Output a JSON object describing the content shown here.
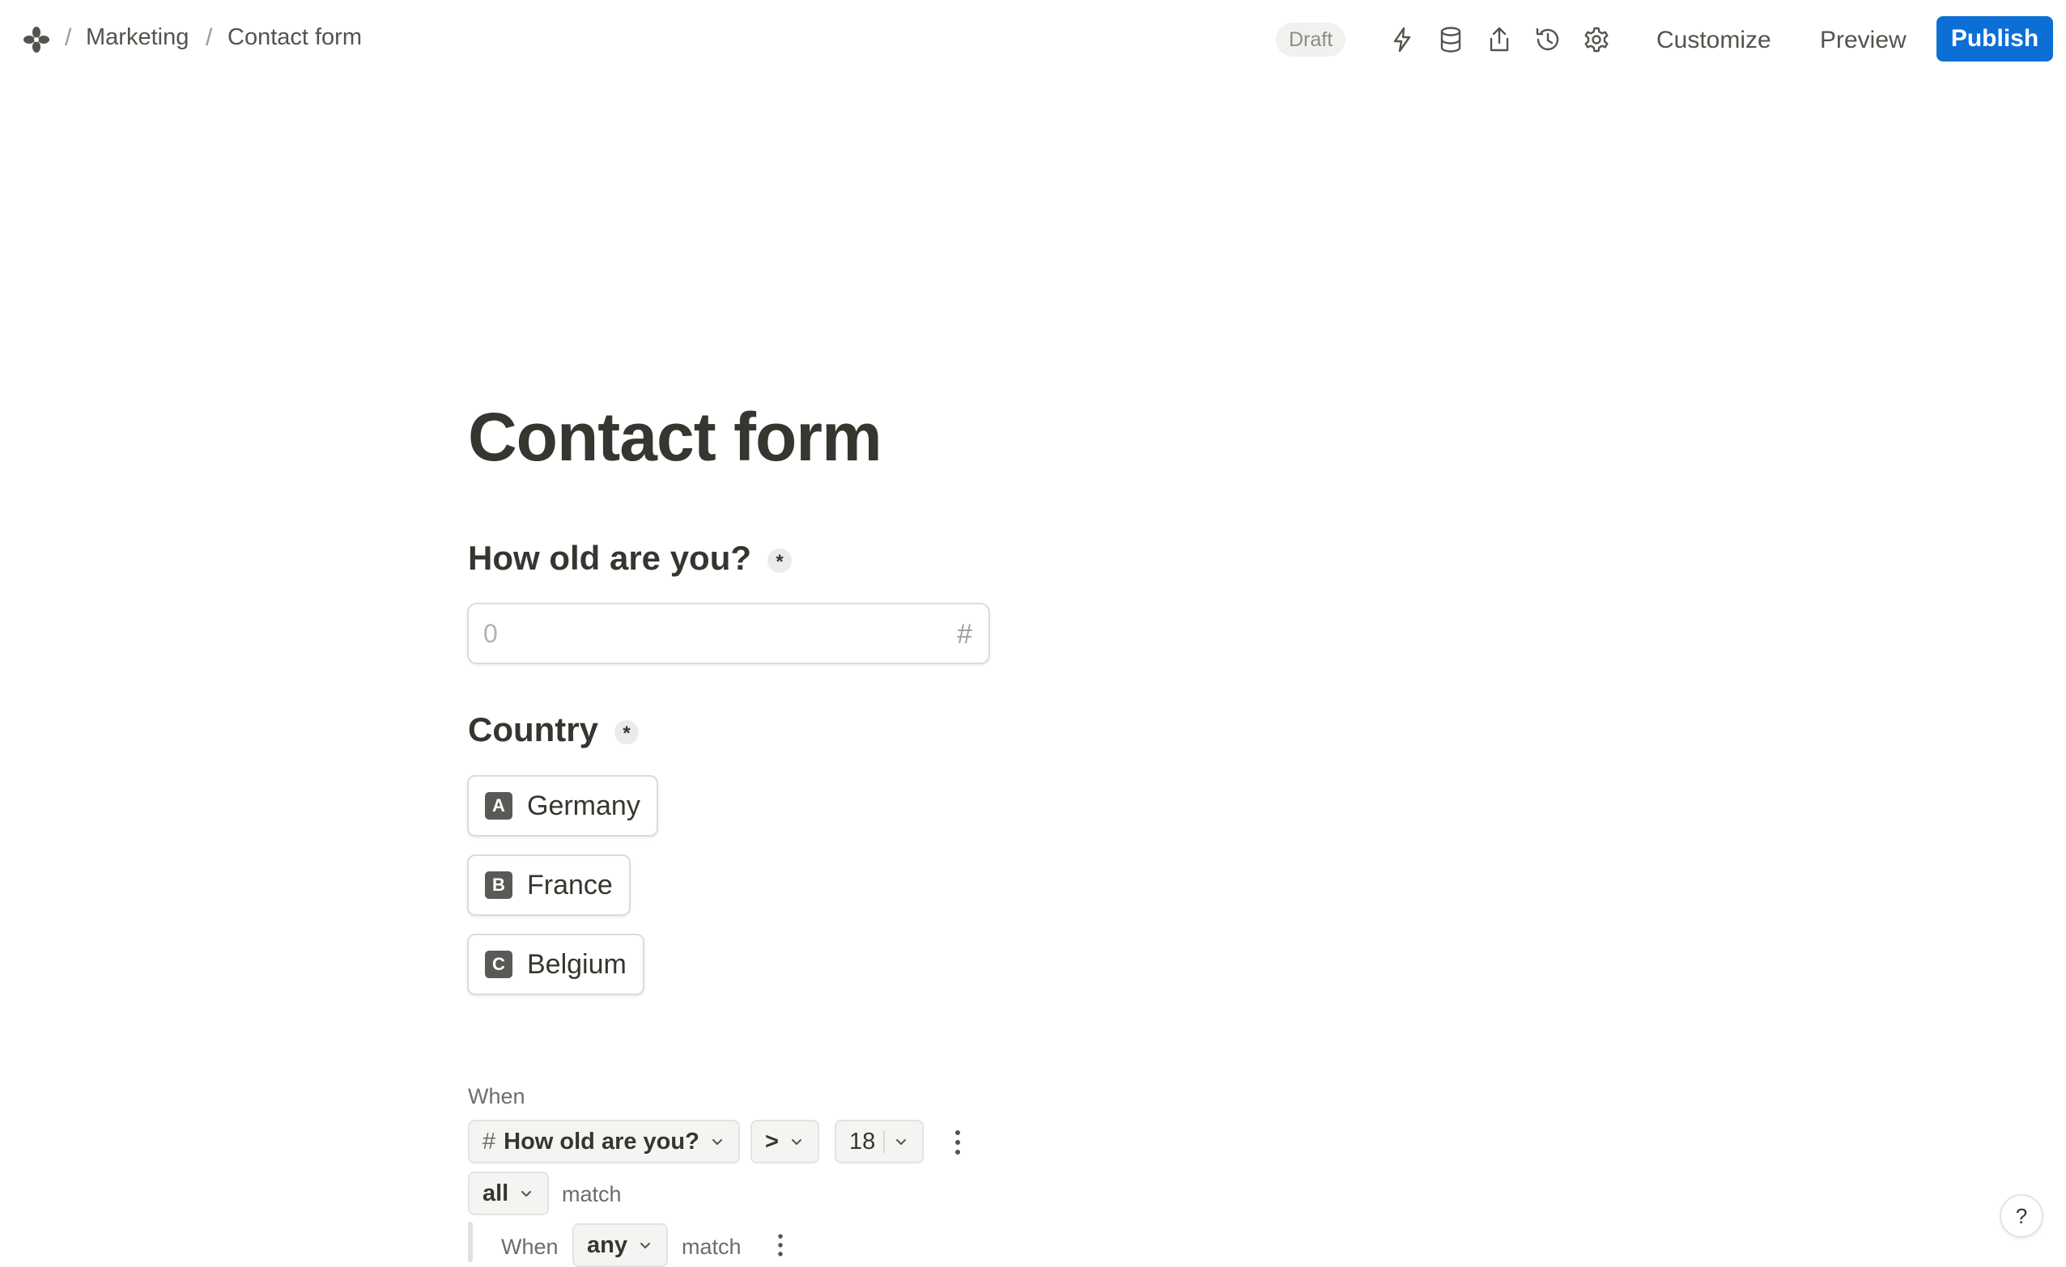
{
  "breadcrumb": {
    "separator": "/",
    "items": [
      "Marketing",
      "Contact form"
    ]
  },
  "status": {
    "label": "Draft"
  },
  "toolbar": {
    "icons": [
      "lightning-icon",
      "database-icon",
      "share-icon",
      "history-icon",
      "gear-icon"
    ],
    "customize_label": "Customize",
    "preview_label": "Preview",
    "publish_label": "Publish"
  },
  "colors": {
    "accent": "#0b6fd6",
    "text": "#37352f"
  },
  "form": {
    "title": "Contact form",
    "questions": [
      {
        "label": "How old are you?",
        "required_mark": "*",
        "type": "number",
        "placeholder": "0",
        "type_icon": "#"
      },
      {
        "label": "Country",
        "required_mark": "*",
        "type": "choice",
        "options": [
          {
            "key": "A",
            "label": "Germany"
          },
          {
            "key": "B",
            "label": "France"
          },
          {
            "key": "C",
            "label": "Belgium"
          }
        ]
      }
    ]
  },
  "logic": {
    "when_label": "When",
    "condition": {
      "field_icon": "#",
      "field": "How old are you?",
      "operator": ">",
      "value": "18"
    },
    "match_mode": "all",
    "match_label": "match",
    "nested": {
      "when_label": "When",
      "match_mode": "any",
      "match_label": "match"
    }
  },
  "help": {
    "label": "?"
  }
}
